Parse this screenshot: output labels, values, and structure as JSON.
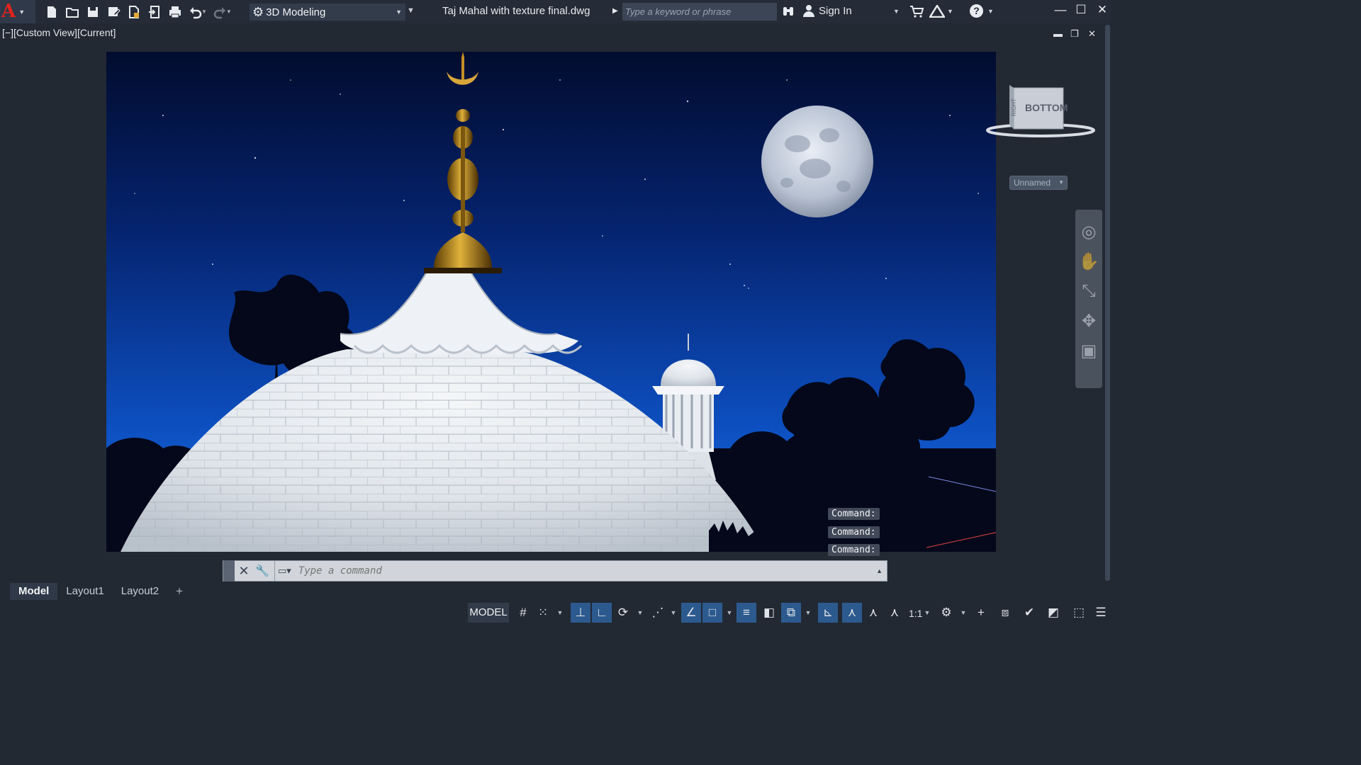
{
  "app": {
    "logo_letter": "A",
    "workspace": "3D Modeling",
    "file_title": "Taj Mahal with texture final.dwg",
    "search_placeholder": "Type a keyword or phrase",
    "sign_in": "Sign In",
    "help": "?"
  },
  "quick_access": [
    "new-icon",
    "open-icon",
    "save-icon",
    "save-as-icon",
    "open-web-icon",
    "save-web-icon",
    "plot-icon",
    "undo-icon",
    "redo-icon"
  ],
  "viewport": {
    "label": "[−][Custom View][Current]",
    "viewcube_face_top": "BOTTOM",
    "viewcube_face_side": "RIGHT",
    "named_view": "Unnamed"
  },
  "command": {
    "history": [
      "Command:",
      "Command:",
      "Command:"
    ],
    "placeholder": "Type a command"
  },
  "layout_tabs": [
    {
      "label": "Model",
      "active": true
    },
    {
      "label": "Layout1",
      "active": false
    },
    {
      "label": "Layout2",
      "active": false
    }
  ],
  "status": {
    "model": "MODEL",
    "scale": "1:1"
  },
  "colors": {
    "accent_red": "#e0231b",
    "chrome_dark": "#222933",
    "active_toggle": "#2c5a8f",
    "sky_top": "#020c2e",
    "sky_bottom": "#1a6fe0"
  }
}
